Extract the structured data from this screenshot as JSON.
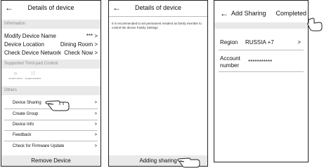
{
  "screen1": {
    "title": "Details of device",
    "section_information": "Information",
    "modify_name_label": "Modify Device Name",
    "modify_name_value": "*** >",
    "location_label": "Device Location",
    "location_value": "Dining Room >",
    "network_label": "Check Device Network",
    "network_value": "Check Now >",
    "section_third_party": "Supported Third-part Control",
    "tp1_label": "Amazon Alexa",
    "tp2_label": "Google Assistant",
    "section_others": "Others",
    "others": [
      {
        "label": "Device Sharing",
        "chev": ">"
      },
      {
        "label": "Create Group",
        "chev": ">"
      },
      {
        "label": "Device Info",
        "chev": ">"
      },
      {
        "label": "Feedback",
        "chev": ">"
      },
      {
        "label": "Check for Firmware Update",
        "chev": ">"
      }
    ],
    "remove_button": "Remove Device"
  },
  "screen2": {
    "title": "Details of device",
    "note": "It is recommended to set permanent resident as family member to control the device Family Settings",
    "add_button": "Adding sharing"
  },
  "screen3": {
    "title": "Add Sharing",
    "completed": "Completed",
    "region_label": "Region",
    "region_value": "RUSSIA +7",
    "region_chev": ">",
    "account_label": "Account number",
    "account_value": "***********"
  },
  "icons": {
    "back": "arrow-left-icon",
    "hand": "pointing-hand-icon",
    "alexa": "alexa-icon",
    "google": "google-assistant-icon"
  }
}
